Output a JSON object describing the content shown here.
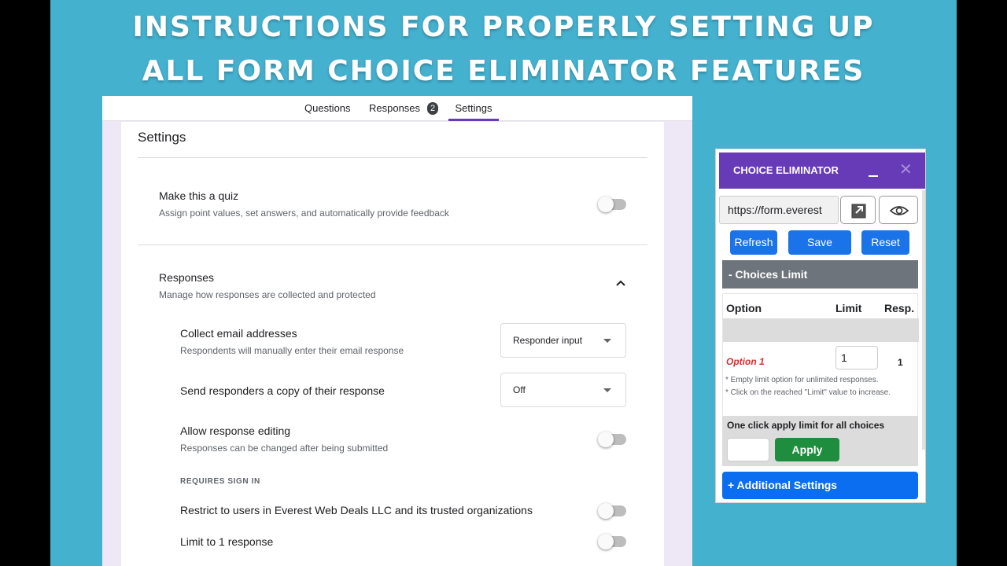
{
  "banner": {
    "line1": "INSTRUCTIONS FOR PROPERLY SETTING UP",
    "line2": "ALL FORM CHOICE ELIMINATOR FEATURES"
  },
  "form": {
    "tabs": {
      "questions": "Questions",
      "responses": "Responses",
      "responses_badge": "2",
      "settings": "Settings"
    },
    "heading": "Settings",
    "quiz": {
      "title": "Make this a quiz",
      "subtitle": "Assign point values, set answers, and automatically provide feedback",
      "enabled": false
    },
    "responses": {
      "title": "Responses",
      "subtitle": "Manage how responses are collected and protected",
      "expanded": true
    },
    "collect_email": {
      "title": "Collect email addresses",
      "subtitle": "Respondents will manually enter their email response",
      "value": "Responder input"
    },
    "send_copy": {
      "title": "Send responders a copy of their response",
      "value": "Off"
    },
    "allow_editing": {
      "title": "Allow response editing",
      "subtitle": "Responses can be changed after being submitted",
      "enabled": false
    },
    "requires_sign_in_label": "REQUIRES SIGN IN",
    "restrict_users": {
      "title": "Restrict to users in Everest Web Deals LLC and its trusted organizations",
      "enabled": false
    },
    "limit_one": {
      "title": "Limit to 1 response",
      "enabled": false
    },
    "colors": {
      "accent": "#673ab7",
      "content_bg": "#ede7f6"
    }
  },
  "choice_eliminator": {
    "title": "CHOICE ELIMINATOR",
    "url_value": "https://form.everest",
    "buttons": {
      "refresh": "Refresh",
      "save": "Save",
      "reset": "Reset"
    },
    "choices_limit_label": "- Choices Limit",
    "table_headers": {
      "option": "Option",
      "limit": "Limit",
      "resp": "Resp."
    },
    "rows": [
      {
        "option": "Option 1",
        "limit": "1",
        "resp": "1"
      }
    ],
    "notes": [
      "* Empty limit option for unlimited responses.",
      "* Click on the reached \"Limit\" value to increase."
    ],
    "one_click_label": "One click apply limit for all choices",
    "apply_label": "Apply",
    "additional_settings": "+ Additional Settings",
    "icons": {
      "open": "external-link-icon",
      "view": "eye-icon",
      "minimize": "minimize-icon",
      "close": "close-icon"
    },
    "colors": {
      "header": "#673ab7",
      "primary": "#1a73e8",
      "apply": "#1e8e3e",
      "option_text": "#d32f2f"
    }
  },
  "colors": {
    "stage_bg": "#44b1cf"
  }
}
